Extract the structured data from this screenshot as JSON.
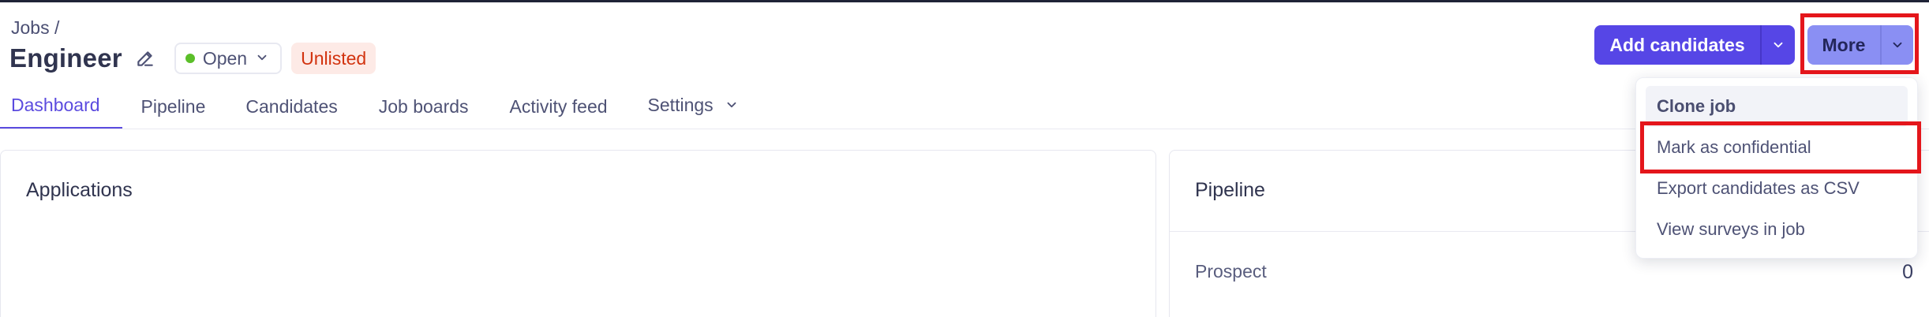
{
  "header": {
    "breadcrumb": "Jobs /",
    "title": "Engineer",
    "status": "Open",
    "visibility_badge": "Unlisted"
  },
  "actions": {
    "add_candidates_label": "Add candidates",
    "more_label": "More"
  },
  "tabs": [
    {
      "label": "Dashboard",
      "active": true
    },
    {
      "label": "Pipeline"
    },
    {
      "label": "Candidates"
    },
    {
      "label": "Job boards"
    },
    {
      "label": "Activity feed"
    },
    {
      "label": "Settings"
    }
  ],
  "more_menu": {
    "items": [
      {
        "label": "Clone job"
      },
      {
        "label": "Mark as confidential"
      },
      {
        "label": "Export candidates as CSV"
      },
      {
        "label": "View surveys in job"
      }
    ]
  },
  "cards": {
    "applications": {
      "title": "Applications"
    },
    "pipeline": {
      "title": "Pipeline",
      "rows": [
        {
          "label": "Prospect",
          "value": "0"
        }
      ]
    }
  },
  "colors": {
    "accent": "#5646e6",
    "more_button": "#8a8ff3",
    "status_open": "#5bbf29",
    "unlisted_bg": "#fdeae6",
    "unlisted_text": "#d2330f",
    "highlight_box": "#e4161b"
  },
  "icons": {
    "edit": "pencil-icon",
    "dropdown": "chevron-down-icon"
  }
}
